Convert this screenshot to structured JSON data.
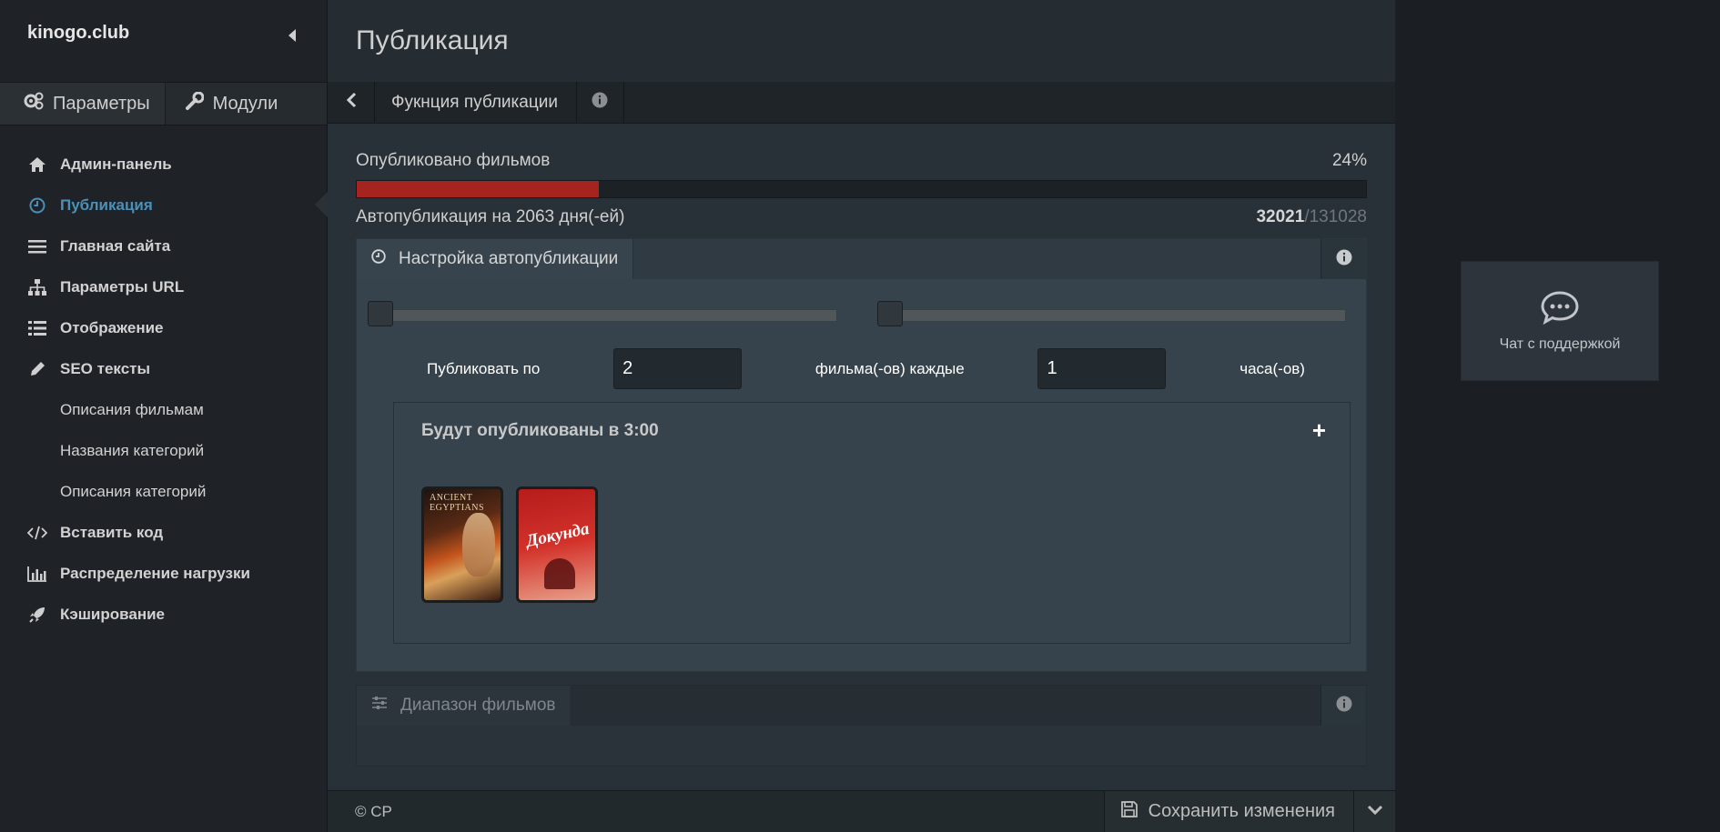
{
  "brand": {
    "name": "kinogo.club"
  },
  "sidebar": {
    "tabs": [
      {
        "label": "Параметры",
        "icon": "cogs-icon"
      },
      {
        "label": "Модули",
        "icon": "wrench-icon"
      }
    ],
    "items": [
      {
        "label": "Админ-панель",
        "icon": "home-icon"
      },
      {
        "label": "Публикация",
        "icon": "clock-icon",
        "active": true
      },
      {
        "label": "Главная сайта",
        "icon": "bars-icon"
      },
      {
        "label": "Параметры URL",
        "icon": "sitemap-icon"
      },
      {
        "label": "Отображение",
        "icon": "list-icon"
      },
      {
        "label": "SEO тексты",
        "icon": "pencil-icon"
      },
      {
        "label": "Описания фильмам",
        "sub": true
      },
      {
        "label": "Названия категорий",
        "sub": true
      },
      {
        "label": "Описания категорий",
        "sub": true
      },
      {
        "label": "Вставить код",
        "icon": "code-icon"
      },
      {
        "label": "Распределение нагрузки",
        "icon": "bar-chart-icon"
      },
      {
        "label": "Кэширование",
        "icon": "rocket-icon"
      }
    ]
  },
  "page": {
    "title": "Публикация",
    "toolbar": {
      "label": "Фукнция публикации"
    }
  },
  "stats": {
    "published_label": "Опубликовано фильмов",
    "percent_text": "24%",
    "progress_fraction": 0.24,
    "autopub_label": "Автопубликация на 2063 дня(-ей)",
    "published_count": "32021",
    "total_count": "/131028"
  },
  "autopub": {
    "tab_label": "Настройка автопубликации",
    "slider1_position": 0.0,
    "slider2_position": 0.0,
    "publish_by_label": "Публиковать по",
    "films_value": "2",
    "films_every_label": "фильма(-ов) каждые",
    "hours_value": "1",
    "hours_label": "часа(-ов)",
    "queue_title": "Будут опубликованы в 3:00",
    "posters": [
      {
        "name": "poster-ancient-egyptians",
        "title": "ANCIENT EGYPTIANS"
      },
      {
        "name": "poster-dokunda",
        "title": "Докунда"
      }
    ]
  },
  "range_panel": {
    "tab_label": "Диапазон фильмов"
  },
  "footer": {
    "copyright": "© CP",
    "save_label": "Сохранить изменения"
  },
  "support": {
    "label": "Чат с поддержкой"
  },
  "colors": {
    "accent": "#4d8fb6",
    "progress": "#a52420"
  }
}
